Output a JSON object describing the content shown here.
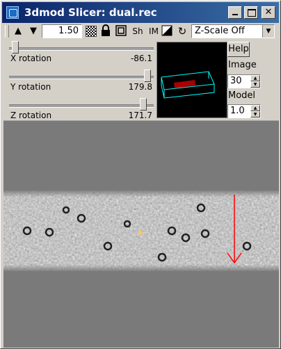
{
  "window": {
    "title": "3dmod Slicer: dual.rec"
  },
  "toolbar": {
    "zoom_value": "1.50",
    "sh_label": "Sh",
    "im_label": "IM",
    "z_scale": "Z-Scale Off"
  },
  "sliders": {
    "x": {
      "label": "X rotation",
      "value": "-86.1",
      "fraction": 0.02
    },
    "y": {
      "label": "Y rotation",
      "value": "179.8",
      "fraction": 0.98
    },
    "z": {
      "label": "Z rotation",
      "value": "171.7",
      "fraction": 0.95
    }
  },
  "right_panel": {
    "help_label": "Help",
    "image_label": "Image",
    "image_value": "30",
    "model_label": "Model",
    "model_value": "1.0"
  },
  "colors": {
    "title_gradient_start": "#0a246a",
    "title_gradient_end": "#3a6ea5",
    "box_outline": "#00ffff",
    "slab": "#a80000",
    "arrow": "#ff0000",
    "background_gray": "#7a7a7a"
  }
}
